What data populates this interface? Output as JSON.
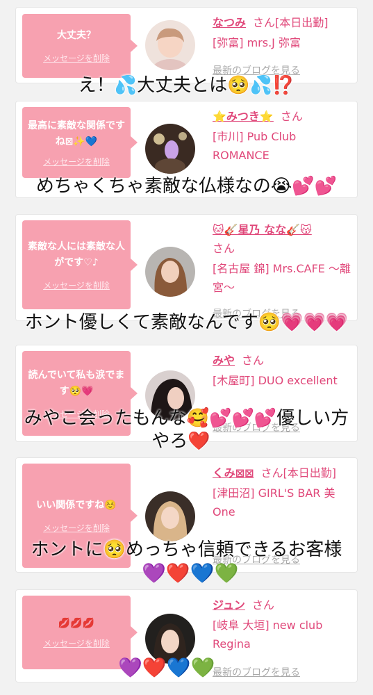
{
  "delete_label": "メッセージを削除",
  "blog_label": "最新のブログを見る",
  "cards": [
    {
      "message": "大丈夫？",
      "name": "なつみ",
      "san": "さん[本日出勤]",
      "shop": "[弥富] mrs.J 弥富",
      "overlay": "え！💦大丈夫とは🥺💦⁉️"
    },
    {
      "message": "最高に素敵な関係ですね⊠✨💙",
      "name": "⭐みつき⭐",
      "san": "さん",
      "shop": "[市川] Pub Club ROMANCE",
      "overlay": "めちゃくちゃ素敵な仏様なの😭💕💕"
    },
    {
      "message": "素敵な人には素敵な人がです♡♪",
      "name": "🐱🎸星乃 なな🎸😽",
      "san": "さん",
      "shop": "[名古屋 錦] Mrs.CAFE ～離宮～",
      "overlay": "ホント優しくて素敵なんです🥺💗💗💗"
    },
    {
      "message": "読んでいて私も涙でます🥺💗",
      "name": "みや",
      "san": "さん",
      "shop": "[木屋町] DUO excellent",
      "overlay": "みやこ会ったもんな🥰💕💕💕優しい方",
      "overlay2": "やろ❤️"
    },
    {
      "message": "いい関係ですね☺️",
      "name": "くみ⊠⊠",
      "san": "さん[本日出勤]",
      "shop": "[津田沼] GIRL'S BAR 美One",
      "overlay": "ホントに🥺めっちゃ信頼できるお客様",
      "hearts": "💜❤️💙💚"
    },
    {
      "message": "💋💋💋",
      "name": "ジュン",
      "san": "さん",
      "shop": "[岐阜 大垣] new club Regina",
      "hearts": "💜❤️💙💚"
    }
  ]
}
